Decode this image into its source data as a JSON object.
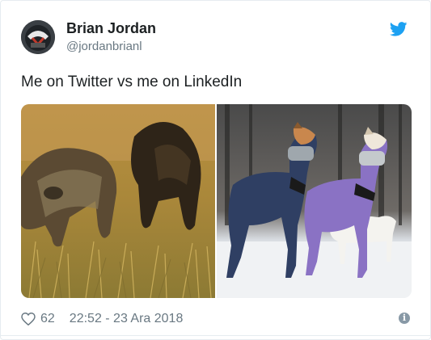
{
  "author": {
    "name": "Brian Jordan",
    "handle": "@jordanbrianl"
  },
  "tweet": {
    "text": "Me on Twitter vs me on LinkedIn"
  },
  "footer": {
    "like_count": "62",
    "timestamp": "22:52 - 23 Ara 2018"
  },
  "icons": {
    "brand": "twitter-bird-icon",
    "like": "heart-icon",
    "info": "info-icon"
  },
  "colors": {
    "brand_blue": "#1da1f2",
    "secondary_text": "#697882",
    "primary_text": "#1c2022"
  }
}
